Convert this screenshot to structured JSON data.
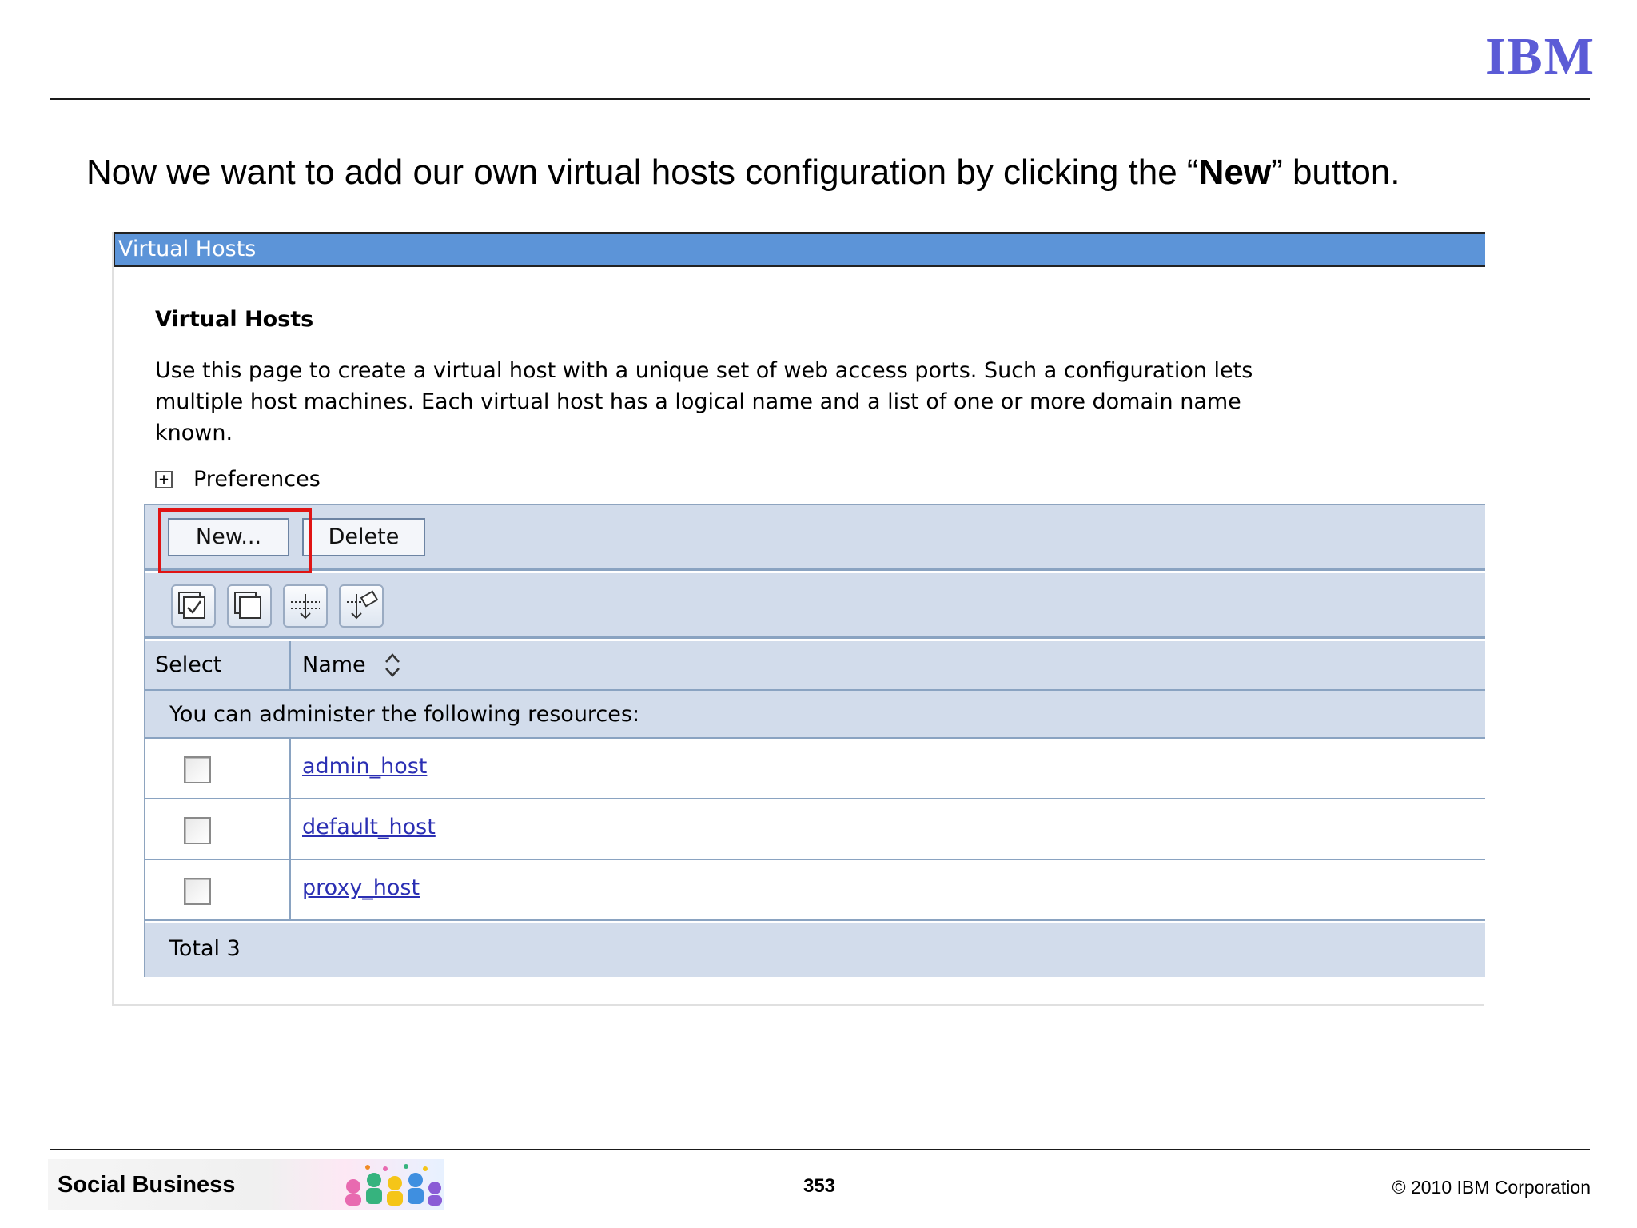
{
  "slide": {
    "logo": "IBM",
    "headline_pre": "Now we want to add our own virtual hosts configuration by clicking the “",
    "headline_bold": "New",
    "headline_post": "” button.",
    "footer_brand": "Social Business",
    "page_number": "353",
    "copyright": "© 2010 IBM Corporation"
  },
  "panel": {
    "title_bar": "Virtual Hosts",
    "section_title": "Virtual Hosts",
    "description_lines": [
      "Use this page to create a virtual host with a unique set of web access ports. Such a configuration lets",
      "multiple host machines. Each virtual host has a logical name and a list of one or more domain name",
      "known."
    ],
    "preferences_label": "Preferences",
    "buttons": {
      "new_label": "New...",
      "delete_label": "Delete"
    },
    "toolbar_icons": [
      "select-all-icon",
      "deselect-all-icon",
      "show-filter-icon",
      "clear-filter-icon"
    ],
    "table": {
      "col_select": "Select",
      "col_name": "Name",
      "message": "You can administer the following resources:",
      "rows": [
        {
          "name": "admin_host"
        },
        {
          "name": "default_host"
        },
        {
          "name": "proxy_host"
        }
      ],
      "total": "Total 3"
    }
  },
  "colors": {
    "title_bar": "#5c94d8",
    "table_band": "#d2dceb",
    "highlight": "#e01414",
    "link": "#2b2fb3",
    "ibm_blue": "#5b5bd6"
  }
}
